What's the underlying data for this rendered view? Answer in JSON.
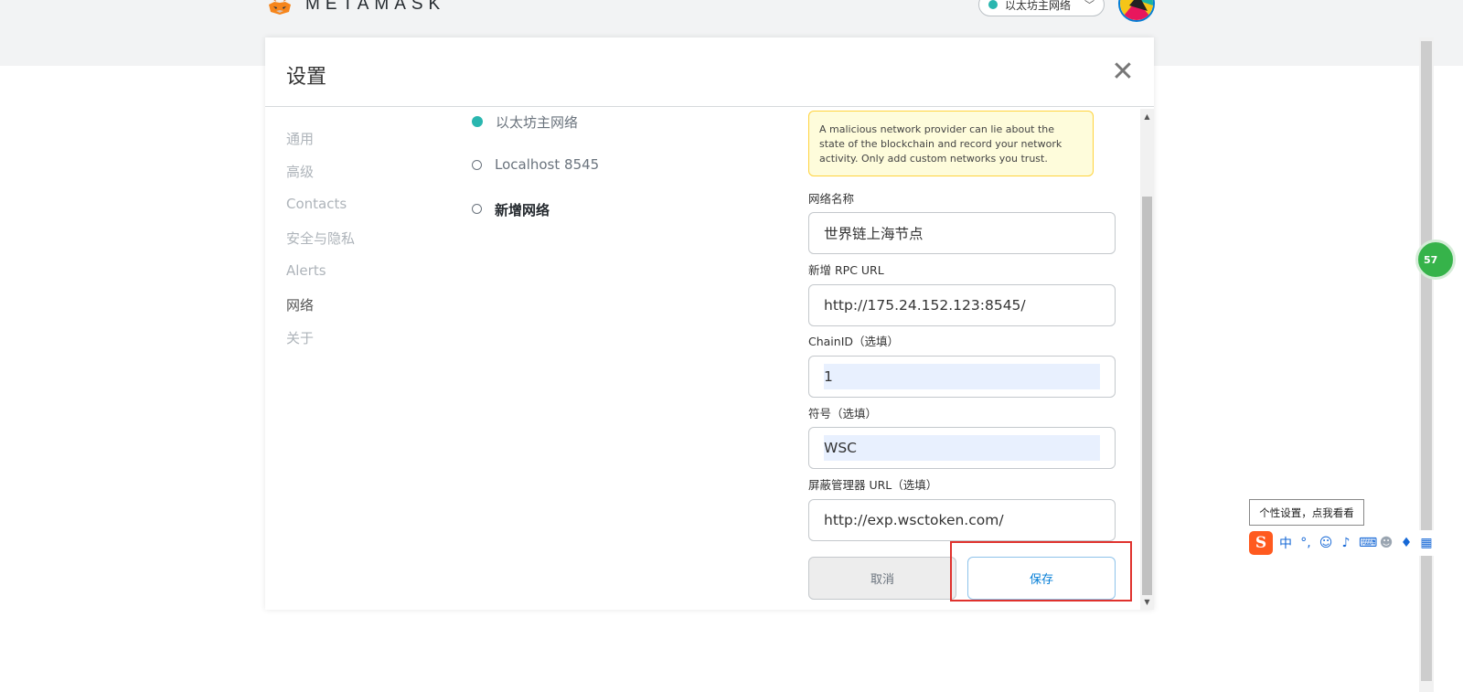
{
  "header": {
    "brand": "METAMASK",
    "network_selector": "以太坊主网络",
    "chevron": "chevron-down-icon",
    "colors": {
      "topband": "#f2f3f4",
      "network_dot": "#29b6af"
    }
  },
  "modal": {
    "title": "设置",
    "close_label": "✕"
  },
  "sidebar": {
    "items": [
      {
        "label": "通用"
      },
      {
        "label": "高级"
      },
      {
        "label": "Contacts"
      },
      {
        "label": "安全与隐私"
      },
      {
        "label": "Alerts"
      },
      {
        "label": "网络"
      },
      {
        "label": "关于"
      }
    ],
    "active": "网络"
  },
  "networks": {
    "items": [
      {
        "label": "以太坊主网络"
      },
      {
        "label": "Localhost 8545"
      },
      {
        "label": "新增网络"
      }
    ]
  },
  "form": {
    "warning": "A malicious network provider can lie about the state of the blockchain and record your network activity. Only add custom networks you trust.",
    "network_name_label": "网络名称",
    "network_name_value": "世界链上海节点",
    "rpc_label": "新增 RPC URL",
    "rpc_value": "http://175.24.152.123:8545/",
    "chainid_label": "ChainID（选填）",
    "chainid_value": "1",
    "symbol_label": "符号（选填）",
    "symbol_value": "WSC",
    "explorer_label": "屏蔽管理器 URL（选填）",
    "explorer_value": "http://exp.wsctoken.com/",
    "cancel_label": "取消",
    "save_label": "保存",
    "colors": {
      "accent": "#037dd6",
      "highlight_box": "#e0322d",
      "warning_bg": "#fefcdb"
    }
  },
  "overlay": {
    "bubble_text": "57",
    "ime_tooltip": "个性设置，点我看看",
    "ime_logo": "S",
    "ime_mode": "中",
    "ime_icons": [
      "punctuation-icon",
      "emoji-icon",
      "microphone-icon",
      "keyboard-icon",
      "user-icon",
      "skin-icon",
      "grid-icon"
    ]
  }
}
